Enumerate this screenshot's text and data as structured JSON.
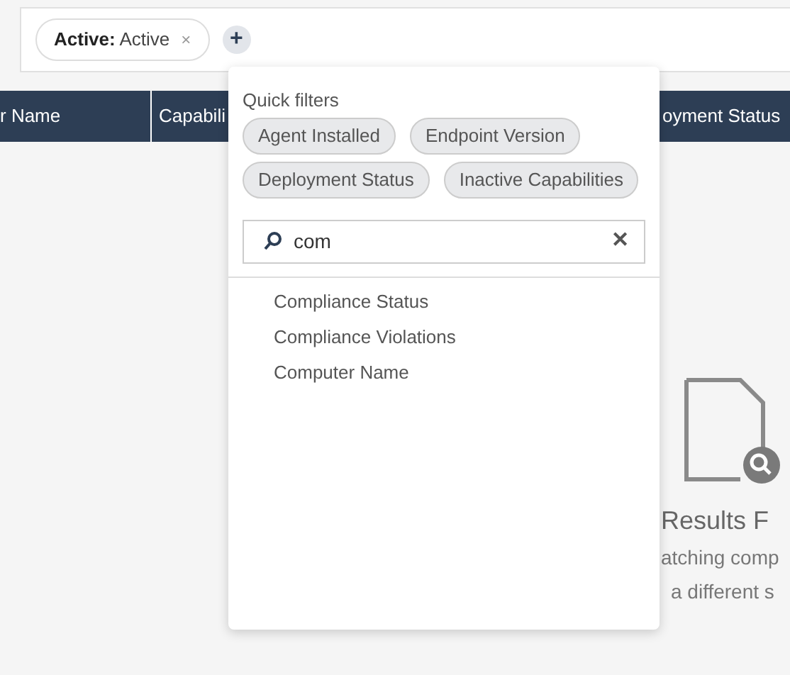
{
  "filter_bar": {
    "chips": [
      {
        "label": "Active:",
        "value": "Active",
        "remove": "×"
      }
    ],
    "add_button": "+"
  },
  "table": {
    "columns": [
      "r Name",
      "Capabili",
      "oyment Status"
    ]
  },
  "empty_state": {
    "title": "Results F",
    "message_lines": [
      "atching comp",
      "a different s"
    ]
  },
  "popover": {
    "section_label": "Quick filters",
    "quick_filters": [
      "Agent Installed",
      "Endpoint Version",
      "Deployment Status",
      "Inactive Capabilities"
    ],
    "search": {
      "value": "com",
      "clear": "✕"
    },
    "results": [
      "Compliance Status",
      "Compliance Violations",
      "Computer Name"
    ]
  }
}
